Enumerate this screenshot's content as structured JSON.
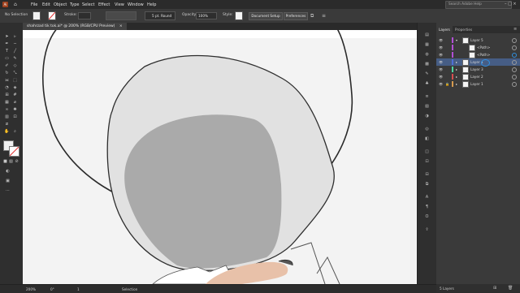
{
  "menubar": {
    "items": [
      "File",
      "Edit",
      "Object",
      "Type",
      "Select",
      "Effect",
      "View",
      "Window",
      "Help"
    ],
    "search_placeholder": "Search Adobe Help"
  },
  "control_bar": {
    "selection": "No Selection",
    "stroke_label": "Stroke:",
    "brush_value": "5 pt. Round",
    "opacity_label": "Opacity:",
    "opacity_value": "100%",
    "style_label": "Style:",
    "document_setup": "Document Setup",
    "preferences": "Preferences"
  },
  "document_tab": {
    "title": "shahrzad tik tok.ai* @ 200% (RGB/CPU Preview)",
    "close": "×"
  },
  "status_bar": {
    "zoom": "200%",
    "angle": "0°",
    "artboard": "1",
    "tool": "Selection",
    "layers_count": "5 Layers"
  },
  "layers_panel": {
    "tabs": [
      "Layers",
      "Properties"
    ],
    "rows": [
      {
        "label": "Layer 5",
        "color": "#b24fd6",
        "indent": 1
      },
      {
        "label": "<Path>",
        "color": "#b24fd6",
        "indent": 2
      },
      {
        "label": "<Path>",
        "color": "#b24fd6",
        "indent": 2
      },
      {
        "label": "Layer 4",
        "color": "#4f6fd6",
        "indent": 1
      },
      {
        "label": "Layer 3",
        "color": "#4fd6a0",
        "indent": 1
      },
      {
        "label": "Layer 2",
        "color": "#d64f4f",
        "indent": 1
      },
      {
        "label": "Layer 1",
        "color": "#d69a4f",
        "indent": 1
      }
    ]
  },
  "colors": {
    "accent": "#2f8fe0",
    "canvas": "#f3f3f3"
  }
}
